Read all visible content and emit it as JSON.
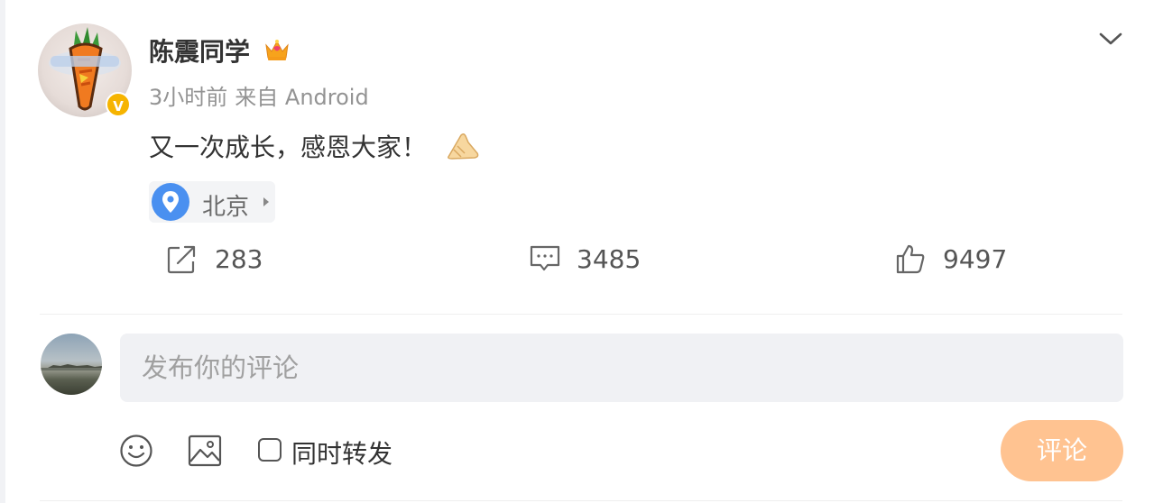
{
  "post": {
    "username": "陈震同学",
    "time": "3小时前",
    "source": "来自 Android",
    "text": "又一次成长，感恩大家！",
    "location": "北京",
    "actions": {
      "repost_count": "283",
      "comment_count": "3485",
      "like_count": "9497"
    }
  },
  "comment_box": {
    "placeholder": "发布你的评论",
    "repost_label": "同时转发",
    "submit_label": "评论"
  },
  "colors": {
    "accent_orange": "#ff8200",
    "submit_disabled": "#ffc391",
    "verified_badge": "#f6b400",
    "location_pin": "#4a90f0"
  },
  "icons": {
    "verified": "v-badge-icon",
    "crown": "crown-icon",
    "more": "chevron-down-icon",
    "location": "location-pin-icon",
    "repost": "repost-icon",
    "comment": "comment-icon",
    "like": "thumbs-up-icon",
    "emoji": "emoji-icon",
    "image": "image-icon"
  }
}
